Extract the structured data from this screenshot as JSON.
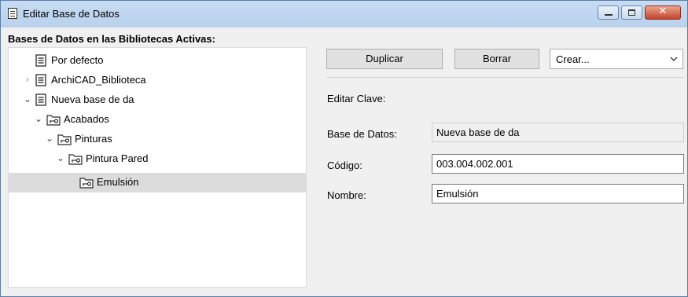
{
  "window": {
    "title": "Editar Base de Datos",
    "icons": {
      "title": "database-icon",
      "minimize": "minimize-icon",
      "maximize": "maximize-icon",
      "close": "close-icon"
    },
    "close_glyph": "✕"
  },
  "tree": {
    "label": "Bases de Datos en las Bibliotecas Activas:",
    "nodes": [
      {
        "label": "Por defecto",
        "icon": "database-icon",
        "expander": ""
      },
      {
        "label": "ArchiCAD_Biblioteca",
        "icon": "database-icon",
        "expander": "›"
      },
      {
        "label": "Nueva base de da",
        "icon": "database-icon",
        "expander": "⌄"
      },
      {
        "label": "Acabados",
        "icon": "key-folder-icon",
        "expander": "⌄"
      },
      {
        "label": "Pinturas",
        "icon": "key-folder-icon",
        "expander": "⌄"
      },
      {
        "label": "Pintura Pared",
        "icon": "key-folder-icon",
        "expander": "⌄"
      },
      {
        "label": "Emulsión",
        "icon": "key-folder-icon",
        "expander": "",
        "selected": true
      }
    ]
  },
  "toolbar": {
    "duplicate_label": "Duplicar",
    "delete_label": "Borrar",
    "create_select": {
      "value": "Crear...",
      "icon": "chevron-down-icon"
    }
  },
  "edit": {
    "section_label": "Editar Clave:",
    "database_label": "Base de Datos:",
    "database_value": "Nueva base de da",
    "code_label": "Código:",
    "code_value": "003.004.002.001",
    "name_label": "Nombre:",
    "name_value": "Emulsión"
  },
  "colors": {
    "titlebar": "#c7dcf3",
    "close_button": "#c7432a",
    "selected_row": "#dcdcdc"
  }
}
